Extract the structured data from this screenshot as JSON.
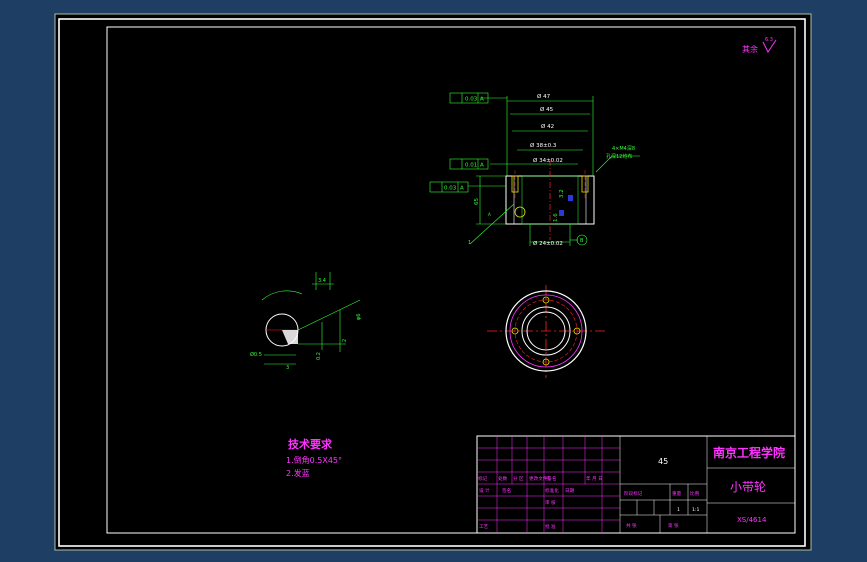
{
  "colors": {
    "background": "#1f3e63",
    "sheet": "#000000",
    "frame": "#a9c1ad",
    "green": "#33ff33",
    "white": "#ffffff",
    "magenta": "#ff33ff",
    "red": "#ff2222",
    "yellow": "#e8e800",
    "blue": "#2a3ad8"
  },
  "surface_finish": {
    "label": "其余",
    "value": "6.3"
  },
  "dimensions": {
    "runout_top": "0.03",
    "d47": "Ø 47",
    "d45": "Ø 45",
    "d42": "Ø 42",
    "d38": "Ø 38±0.3",
    "d34": "Ø 34±0.02",
    "d24": "Ø 24±0.02",
    "perp": "0.01",
    "runout_left": "0.03",
    "height": "65",
    "v32": "3.2",
    "v16": "1.6",
    "thread_note_1": "4×M4深8",
    "thread_note_2": "孔深12均布",
    "datum_a": "A",
    "datum_b": "B",
    "section_a": "A",
    "item_num": "1"
  },
  "detail": {
    "d1": "3.4",
    "d2": "φ6",
    "d3": "2",
    "d4": "Ø0.5",
    "d5": "3",
    "d6": "0.2"
  },
  "tech_req": {
    "title": "技术要求",
    "line1": "1.倒角0.5X45°",
    "line2": "2.发蓝"
  },
  "title_block": {
    "material": "45",
    "school": "南京工程学院",
    "part_name": "小带轮",
    "drawing_no": "XS/4614",
    "header_row": [
      "标记",
      "处数",
      "分 区",
      "更改文件号",
      "签 名",
      "年 月 日"
    ],
    "designer": "设 计",
    "standardize": "标准化",
    "check": "审 核",
    "craft": "工艺",
    "approve": "批 准",
    "date_label": "日期",
    "signature": "签名",
    "stage_mark": "阶段标记",
    "weight": "重量",
    "scale": "比例",
    "scale_value": "1:1",
    "sheets_total": "共 张",
    "sheet_no": "第 张",
    "count": "1"
  }
}
